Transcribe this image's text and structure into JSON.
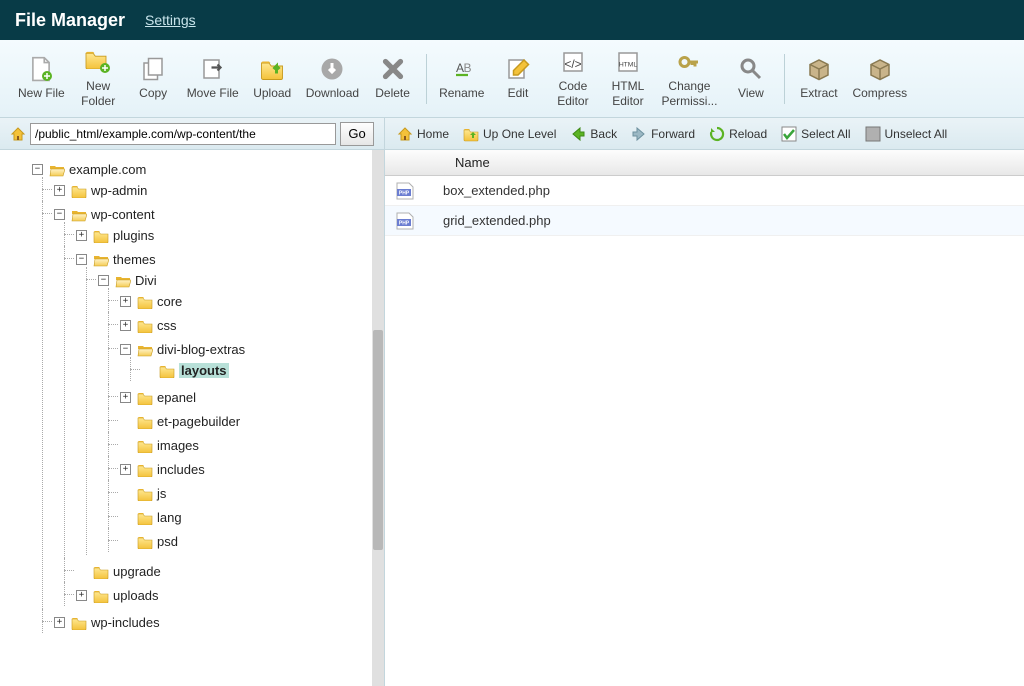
{
  "header": {
    "title": "File Manager",
    "settings": "Settings"
  },
  "toolbar": {
    "new_file": "New File",
    "new_folder": "New\nFolder",
    "copy": "Copy",
    "move_file": "Move File",
    "upload": "Upload",
    "download": "Download",
    "delete": "Delete",
    "rename": "Rename",
    "edit": "Edit",
    "code_editor": "Code\nEditor",
    "html_editor": "HTML\nEditor",
    "change_permissions": "Change\nPermissi...",
    "view": "View",
    "extract": "Extract",
    "compress": "Compress"
  },
  "path": {
    "value": "/public_html/example.com/wp-content/the",
    "go": "Go"
  },
  "right_toolbar": {
    "home": "Home",
    "up": "Up One Level",
    "back": "Back",
    "forward": "Forward",
    "reload": "Reload",
    "select_all": "Select All",
    "unselect_all": "Unselect All"
  },
  "columns": {
    "name": "Name"
  },
  "tree": {
    "root": "example.com",
    "wp_admin": "wp-admin",
    "wp_content": "wp-content",
    "plugins": "plugins",
    "themes": "themes",
    "divi": "Divi",
    "core": "core",
    "css": "css",
    "divi_blog_extras": "divi-blog-extras",
    "layouts": "layouts",
    "epanel": "epanel",
    "et_pagebuilder": "et-pagebuilder",
    "images": "images",
    "includes": "includes",
    "js": "js",
    "lang": "lang",
    "psd": "psd",
    "upgrade": "upgrade",
    "uploads": "uploads",
    "wp_includes": "wp-includes"
  },
  "files": {
    "f1": "box_extended.php",
    "f2": "grid_extended.php"
  }
}
